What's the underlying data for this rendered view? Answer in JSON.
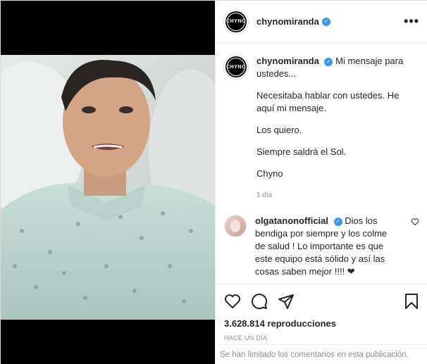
{
  "post": {
    "username": "chynomiranda",
    "avatar_text": "CHYNO",
    "more_label": "•••"
  },
  "caption": {
    "username": "chynomiranda",
    "line1": "Mi mensaje para ustedes...",
    "line2": "Necesitaba hablar con ustedes. He aquí mi mensaje.",
    "line3": "Los quiero.",
    "line4": "Siempre saldrá el Sol.",
    "line5": "Chyno",
    "time": "1 día"
  },
  "comment": {
    "username": "olgatanonofficial",
    "text": "Dios los bendiga por siempre y los colme de salud ! Lo importante es que este equipo está sólido y así las cosas saben mejor !!!! ❤"
  },
  "stats": {
    "views": "3.628.814 reproducciones",
    "ago": "HACE UN DÍA"
  },
  "footer": {
    "limited": "Se han limitado los comentarios en esta publicación."
  },
  "colors": {
    "verified": "#3897f0",
    "muted": "#8e8e8e"
  }
}
